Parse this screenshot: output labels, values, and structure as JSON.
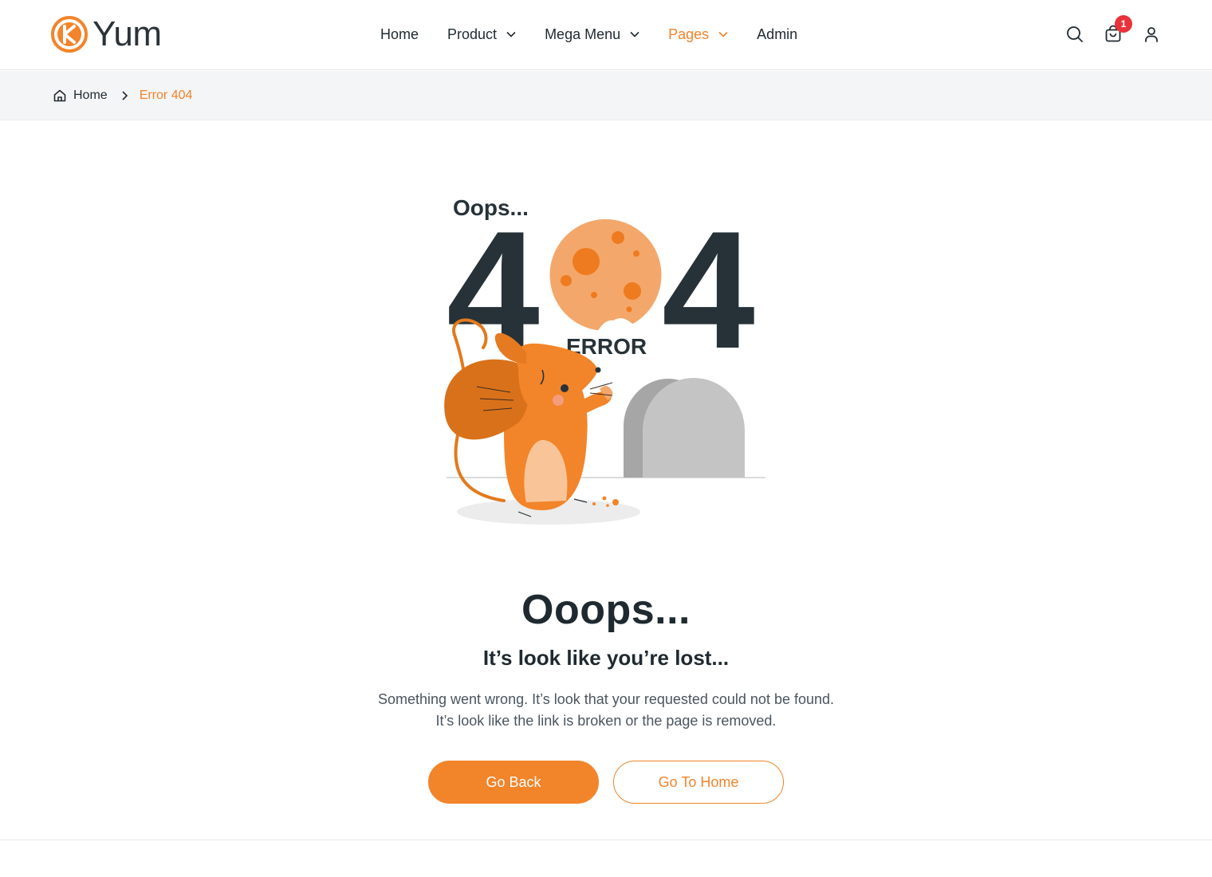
{
  "brand": {
    "name": "Yum",
    "accent": "#f2842a"
  },
  "nav": {
    "items": [
      {
        "label": "Home",
        "dropdown": false,
        "active": false
      },
      {
        "label": "Product",
        "dropdown": true,
        "active": false
      },
      {
        "label": "Mega Menu",
        "dropdown": true,
        "active": false
      },
      {
        "label": "Pages",
        "dropdown": true,
        "active": true
      },
      {
        "label": "Admin",
        "dropdown": false,
        "active": false
      }
    ]
  },
  "header_icons": {
    "search": "search-icon",
    "cart": "cart-icon",
    "cart_count": "1",
    "account": "user-icon"
  },
  "breadcrumb": {
    "home": "Home",
    "current": "Error 404"
  },
  "illustration": {
    "oops_text": "Oops...",
    "code_left": "4",
    "code_right": "4",
    "error_text": "ERROR"
  },
  "content": {
    "title": "Ooops...",
    "subtitle": "It’s look like you’re lost...",
    "desc_line1": "Something went wrong. It’s look that your requested could not be found.",
    "desc_line2": "It’s look like the link is broken or the page is removed."
  },
  "buttons": {
    "back": "Go Back",
    "home": "Go To Home"
  }
}
